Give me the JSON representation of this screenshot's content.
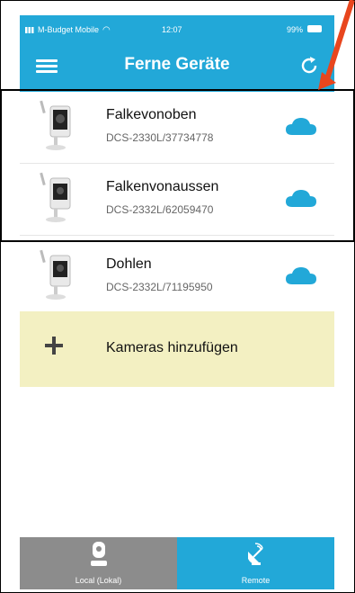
{
  "status_bar": {
    "carrier": "M-Budget Mobile",
    "time": "12:07",
    "battery": "99%"
  },
  "header": {
    "title": "Ferne Geräte"
  },
  "devices": [
    {
      "name": "Falkevonoben",
      "serial": "DCS-2330L/37734778"
    },
    {
      "name": "Falkenvonaussen",
      "serial": "DCS-2332L/62059470"
    },
    {
      "name": "Dohlen",
      "serial": "DCS-2332L/71195950"
    }
  ],
  "add_camera": {
    "label": "Kameras hinzufügen"
  },
  "tabs": [
    {
      "label": "Local (Lokal)"
    },
    {
      "label": "Remote"
    }
  ],
  "colors": {
    "header": "#22a8d8",
    "add_row_bg": "#f3f0c2",
    "local_tab": "#8c8c8c",
    "annotation_arrow": "#e8461e"
  }
}
